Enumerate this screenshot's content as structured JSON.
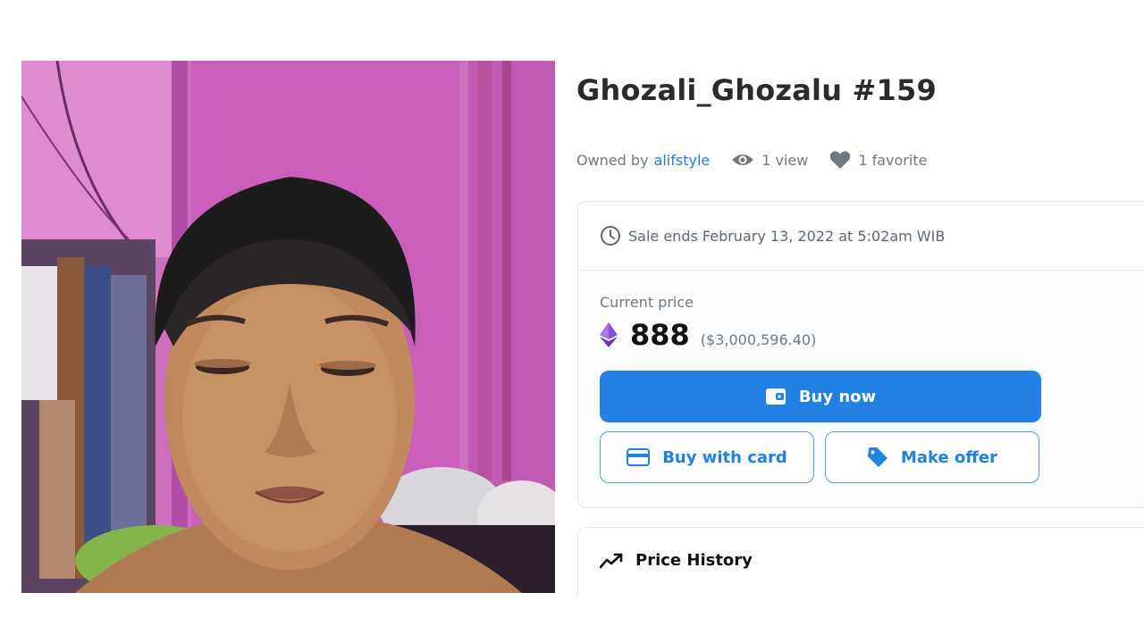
{
  "item": {
    "title": "Ghozali_Ghozalu #159",
    "owned_by_label": "Owned by",
    "owner": "alifstyle",
    "views": "1 view",
    "favorites": "1 favorite"
  },
  "sale": {
    "ends_text": "Sale ends February 13, 2022 at 5:02am WIB",
    "current_price_label": "Current price",
    "price": "888",
    "price_usd": "($3,000,596.40)",
    "currency_icon": "ethereum-icon"
  },
  "actions": {
    "buy_now": "Buy now",
    "buy_with_card": "Buy with card",
    "make_offer": "Make offer"
  },
  "history": {
    "title": "Price History"
  },
  "colors": {
    "accent": "#2081e2",
    "eth": "#8a4fd8",
    "wall": "#d070c0"
  }
}
